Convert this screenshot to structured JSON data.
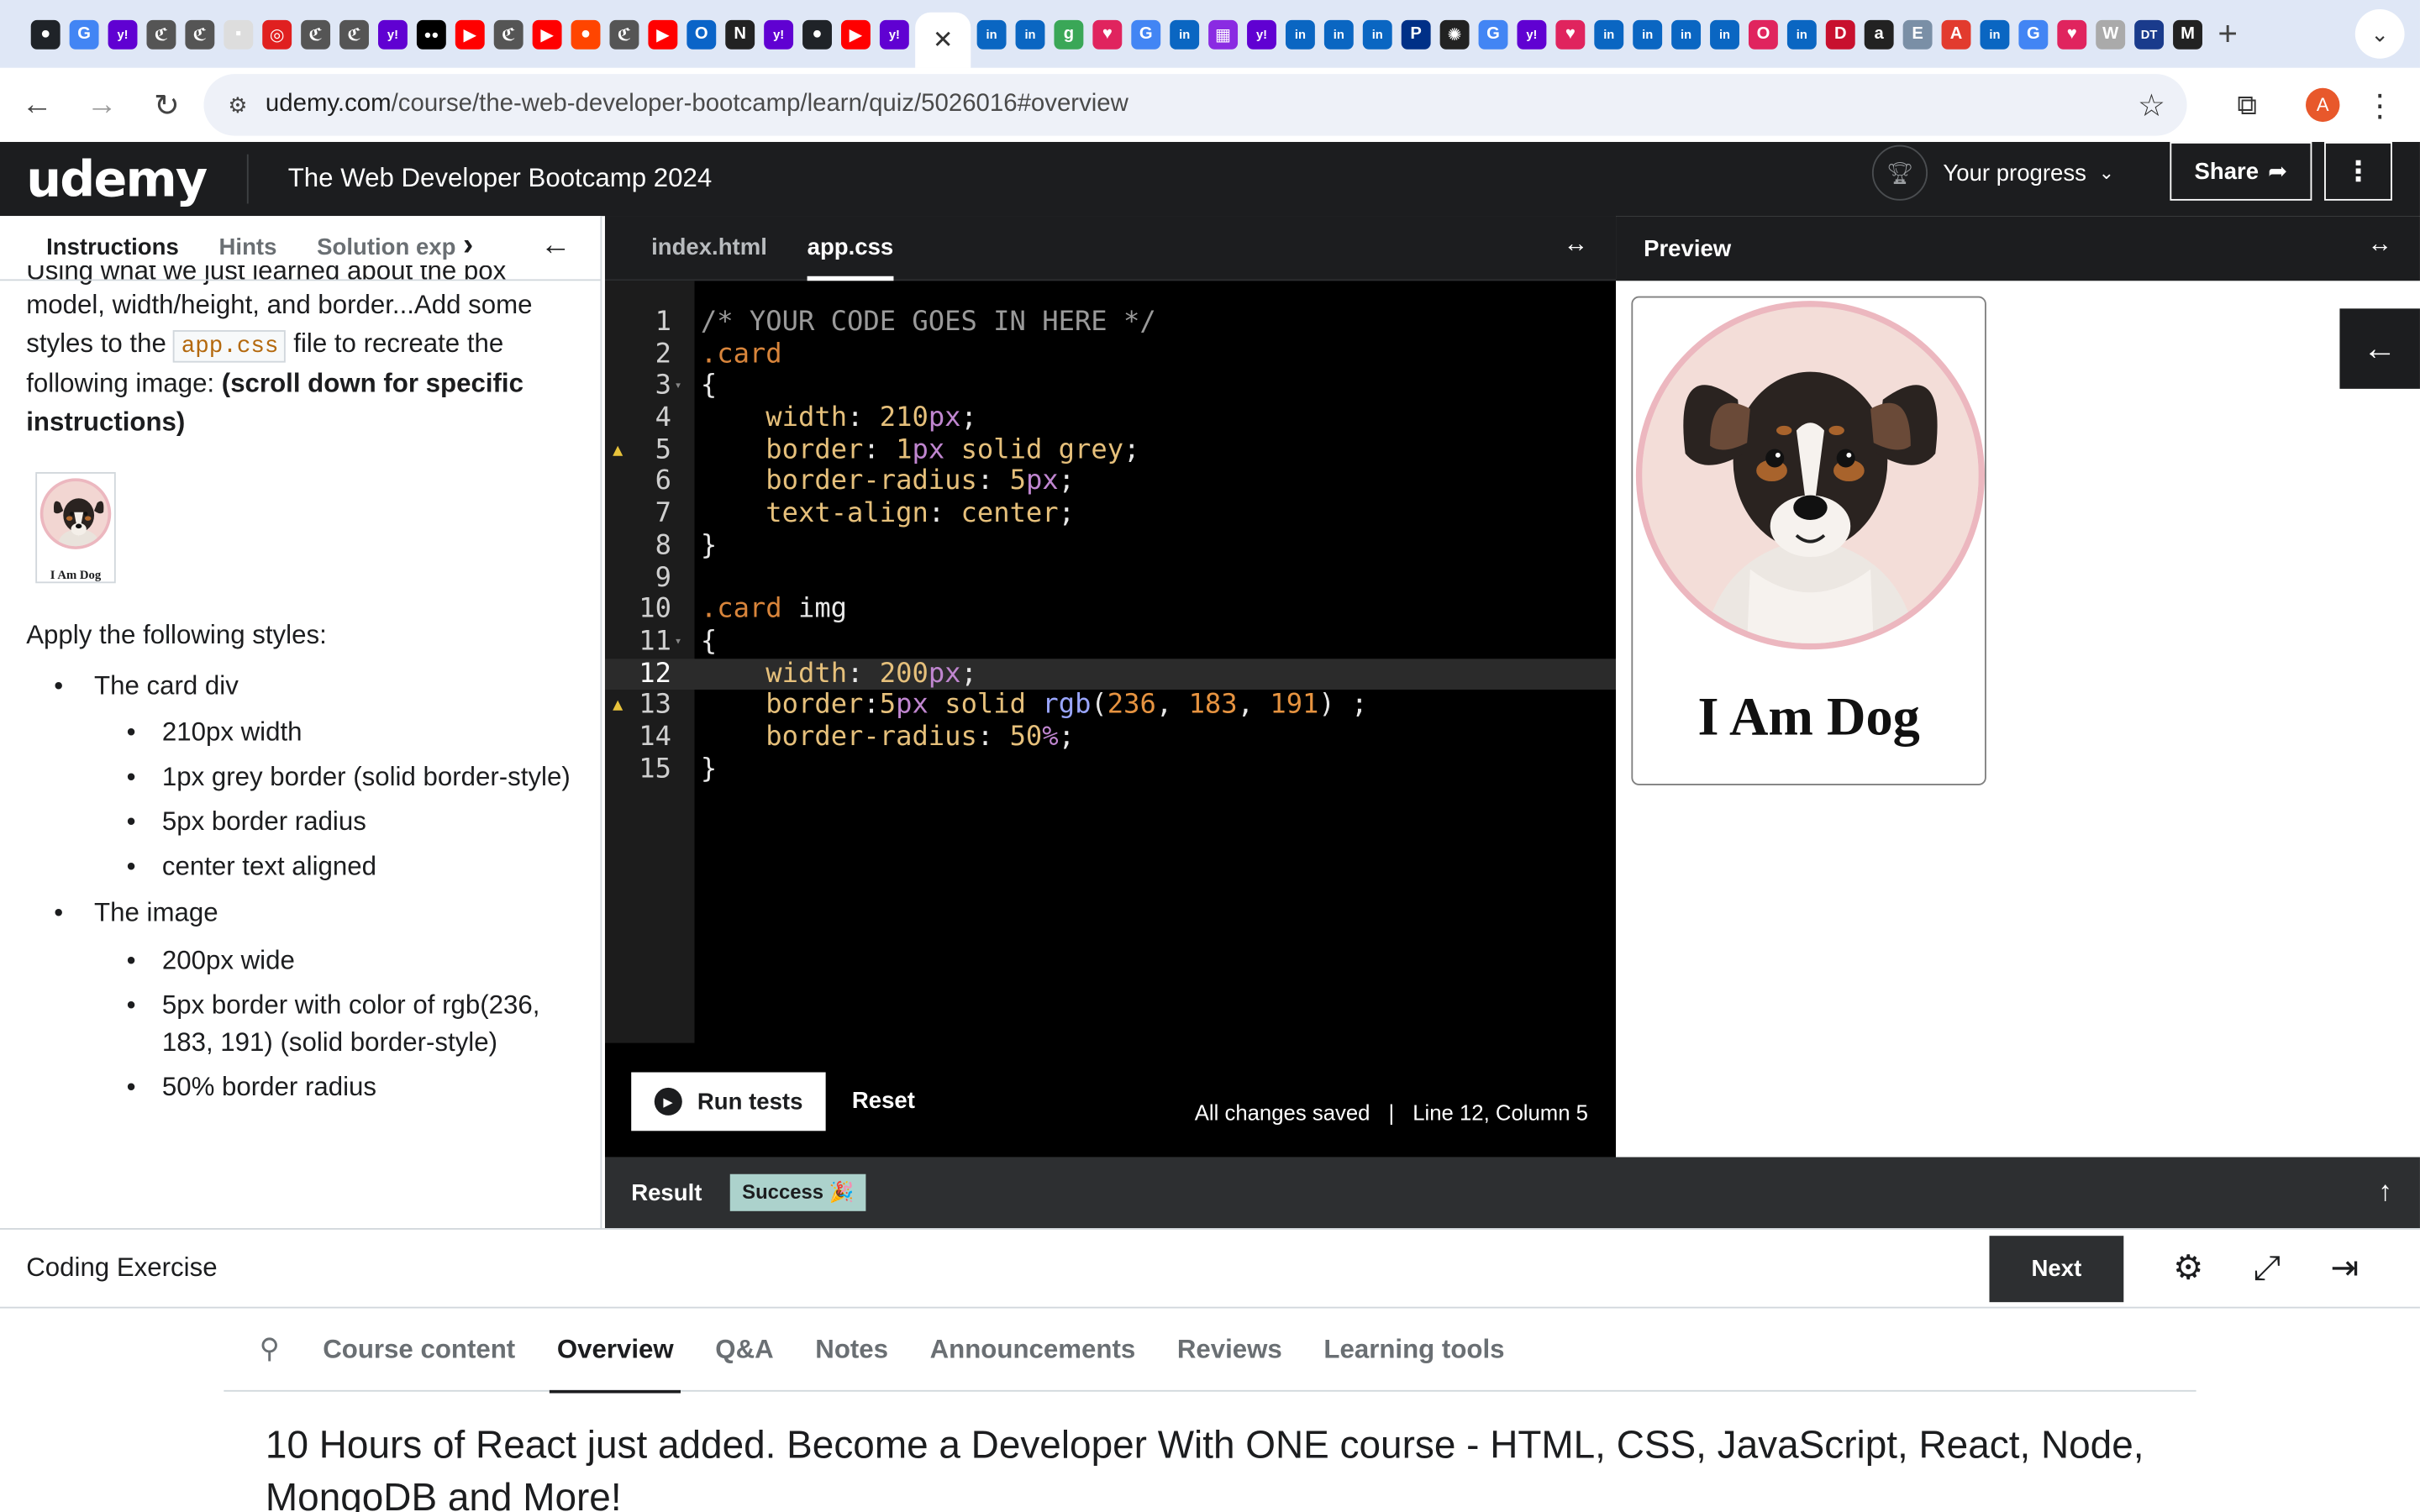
{
  "browser": {
    "active_tab_close": "✕",
    "new_tab": "+",
    "url_domain": "udemy.com",
    "url_path": "/course/the-web-developer-bootcamp/learn/quiz/5026016#overview",
    "profile_initial": "A",
    "favicons": [
      {
        "name": "github-icon",
        "color": "#1f2328",
        "glyph": "●"
      },
      {
        "name": "google-icon",
        "color": "#4285f4",
        "glyph": "G"
      },
      {
        "name": "yahoo-icon",
        "color": "#6001d2",
        "glyph": "y!"
      },
      {
        "name": "chase-icon",
        "color": "#555555",
        "glyph": "ℭ"
      },
      {
        "name": "chase-icon",
        "color": "#555555",
        "glyph": "ℭ"
      },
      {
        "name": "doc-icon",
        "color": "#dddddd",
        "glyph": "▪"
      },
      {
        "name": "target-icon",
        "color": "#e02020",
        "glyph": "◎"
      },
      {
        "name": "chase-icon",
        "color": "#555555",
        "glyph": "ℭ"
      },
      {
        "name": "chase-icon",
        "color": "#555555",
        "glyph": "ℭ"
      },
      {
        "name": "yahoo-icon",
        "color": "#6001d2",
        "glyph": "y!"
      },
      {
        "name": "medium-icon",
        "color": "#000000",
        "glyph": "●●"
      },
      {
        "name": "youtube-icon",
        "color": "#ff0000",
        "glyph": "▶"
      },
      {
        "name": "chase-icon",
        "color": "#555555",
        "glyph": "ℭ"
      },
      {
        "name": "youtube-icon",
        "color": "#ff0000",
        "glyph": "▶"
      },
      {
        "name": "reddit-icon",
        "color": "#ff4500",
        "glyph": "●"
      },
      {
        "name": "chase-icon",
        "color": "#555555",
        "glyph": "ℭ"
      },
      {
        "name": "youtube-icon",
        "color": "#ff0000",
        "glyph": "▶"
      },
      {
        "name": "outlook-icon",
        "color": "#0a64c8",
        "glyph": "O"
      },
      {
        "name": "notion-icon",
        "color": "#222222",
        "glyph": "N"
      },
      {
        "name": "yahoo-icon",
        "color": "#6001d2",
        "glyph": "y!"
      },
      {
        "name": "github-icon",
        "color": "#1f2328",
        "glyph": "●"
      },
      {
        "name": "youtube-icon",
        "color": "#ff0000",
        "glyph": "▶"
      },
      {
        "name": "yahoo-icon",
        "color": "#6001d2",
        "glyph": "y!"
      }
    ],
    "favicons_after": [
      {
        "name": "linkedin-icon",
        "color": "#0a66c2",
        "glyph": "in"
      },
      {
        "name": "linkedin-icon",
        "color": "#0a66c2",
        "glyph": "in"
      },
      {
        "name": "gamma-icon",
        "color": "#3aa757",
        "glyph": "g"
      },
      {
        "name": "heart-icon",
        "color": "#e0245e",
        "glyph": "♥"
      },
      {
        "name": "google-icon",
        "color": "#4285f4",
        "glyph": "G"
      },
      {
        "name": "linkedin-icon",
        "color": "#0a66c2",
        "glyph": "in"
      },
      {
        "name": "flag-icon",
        "color": "#8a2be2",
        "glyph": "▦"
      },
      {
        "name": "yahoo-icon",
        "color": "#6001d2",
        "glyph": "y!"
      },
      {
        "name": "linkedin-icon",
        "color": "#0a66c2",
        "glyph": "in"
      },
      {
        "name": "linkedin-icon",
        "color": "#0a66c2",
        "glyph": "in"
      },
      {
        "name": "linkedin-icon",
        "color": "#0a66c2",
        "glyph": "in"
      },
      {
        "name": "paypal-icon",
        "color": "#003087",
        "glyph": "P"
      },
      {
        "name": "openai-icon",
        "color": "#222222",
        "glyph": "✺"
      },
      {
        "name": "google-icon",
        "color": "#4285f4",
        "glyph": "G"
      },
      {
        "name": "yahoo-icon",
        "color": "#6001d2",
        "glyph": "y!"
      },
      {
        "name": "heart-icon",
        "color": "#e0245e",
        "glyph": "♥"
      },
      {
        "name": "linkedin-icon",
        "color": "#0a66c2",
        "glyph": "in"
      },
      {
        "name": "linkedin-icon",
        "color": "#0a66c2",
        "glyph": "in"
      },
      {
        "name": "linkedin-icon",
        "color": "#0a66c2",
        "glyph": "in"
      },
      {
        "name": "linkedin-icon",
        "color": "#0a66c2",
        "glyph": "in"
      },
      {
        "name": "opera-icon",
        "color": "#e0245e",
        "glyph": "O"
      },
      {
        "name": "linkedin-icon",
        "color": "#0a66c2",
        "glyph": "in"
      },
      {
        "name": "d-icon",
        "color": "#c8102e",
        "glyph": "D"
      },
      {
        "name": "amazon-icon",
        "color": "#222222",
        "glyph": "a"
      },
      {
        "name": "e-icon",
        "color": "#7a8fa6",
        "glyph": "E"
      },
      {
        "name": "adobe-icon",
        "color": "#e23b2e",
        "glyph": "A"
      },
      {
        "name": "linkedin-icon",
        "color": "#0a66c2",
        "glyph": "in"
      },
      {
        "name": "google-icon",
        "color": "#4285f4",
        "glyph": "G"
      },
      {
        "name": "heart-icon",
        "color": "#e0245e",
        "glyph": "♥"
      },
      {
        "name": "w-icon",
        "color": "#aaaaaa",
        "glyph": "W"
      },
      {
        "name": "dans-icon",
        "color": "#1a3b8c",
        "glyph": "DT"
      },
      {
        "name": "m-icon",
        "color": "#222222",
        "glyph": "M"
      }
    ]
  },
  "header": {
    "logo": "udemy",
    "course_title": "The Web Developer Bootcamp 2024",
    "progress_label": "Your progress",
    "share_label": "Share"
  },
  "instructions": {
    "tabs": [
      "Instructions",
      "Hints",
      "Solution exp"
    ],
    "intro_cut": "Using what we just learned about the box",
    "intro_1": "model, width/height, and border...Add some styles to the ",
    "intro_code": "app.css",
    "intro_2": " file to recreate the following image: ",
    "intro_bold": "(scroll down for specific instructions)",
    "thumb_caption": "I Am Dog",
    "apply": "Apply the following styles:",
    "groups": [
      {
        "label": "The card div",
        "items": [
          "210px width",
          "1px grey border (solid border-style)",
          "5px border radius",
          "center text aligned"
        ]
      },
      {
        "label": "The image",
        "items": [
          "200px wide",
          "5px border with color of rgb(236, 183, 191) (solid border-style)",
          "50% border radius"
        ]
      }
    ]
  },
  "editor": {
    "tabs": [
      "index.html",
      "app.css"
    ],
    "active_tab": "app.css",
    "run_label": "Run tests",
    "reset_label": "Reset",
    "saved_status": "All changes saved",
    "separator": "|",
    "cursor_status": "Line 12, Column 5",
    "line_numbers": [
      "1",
      "2",
      "3",
      "4",
      "5",
      "6",
      "7",
      "8",
      "9",
      "10",
      "11",
      "12",
      "13",
      "14",
      "15"
    ]
  },
  "preview": {
    "title": "Preview",
    "card_title": "I Am Dog"
  },
  "result": {
    "label": "Result",
    "badge": "Success 🎉"
  },
  "bottom_bar": {
    "label": "Coding Exercise",
    "next_label": "Next"
  },
  "course_tabs": [
    "Course content",
    "Overview",
    "Q&A",
    "Notes",
    "Announcements",
    "Reviews",
    "Learning tools"
  ],
  "active_course_tab": "Overview",
  "announcement": "10 Hours of React just added. Become a Developer With ONE course - HTML, CSS, JavaScript, React, Node, MongoDB and More!",
  "colors": {
    "udemy_dark": "#1c1d1f",
    "success_badge": "#acd2cc",
    "image_border": "#ecb7bf"
  }
}
